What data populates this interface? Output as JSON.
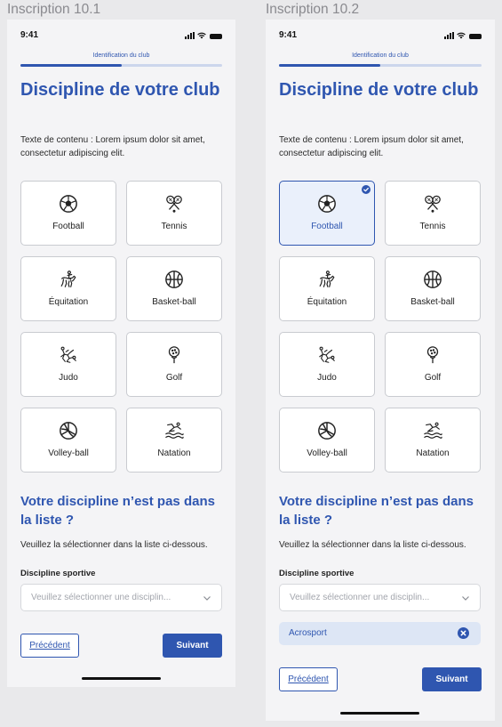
{
  "screens": [
    {
      "frame_title": "Inscription 10.1",
      "status_time": "9:41",
      "step_label": "Identification du club",
      "progress": 0.5,
      "page_title": "Discipline de votre club",
      "intro": "Texte de contenu : Lorem ipsum dolor sit amet, consectetur adipiscing elit.",
      "sports": [
        {
          "label": "Football",
          "icon": "football-icon",
          "selected": false
        },
        {
          "label": "Tennis",
          "icon": "tennis-icon",
          "selected": false
        },
        {
          "label": "Équitation",
          "icon": "equestrian-icon",
          "selected": false
        },
        {
          "label": "Basket-ball",
          "icon": "basketball-icon",
          "selected": false
        },
        {
          "label": "Judo",
          "icon": "judo-icon",
          "selected": false
        },
        {
          "label": "Golf",
          "icon": "golf-icon",
          "selected": false
        },
        {
          "label": "Volley-ball",
          "icon": "volleyball-icon",
          "selected": false
        },
        {
          "label": "Natation",
          "icon": "swimming-icon",
          "selected": false
        }
      ],
      "other_title": "Votre discipline n’est pas dans la liste ?",
      "other_text": "Veuillez la sélectionner dans la liste ci-dessous.",
      "field_label": "Discipline sportive",
      "select_placeholder": "Veuillez sélectionner une disciplin...",
      "prev_label": "Précédent",
      "next_label": "Suivant"
    },
    {
      "frame_title": "Inscription 10.2",
      "status_time": "9:41",
      "step_label": "Identification du club",
      "progress": 0.5,
      "page_title": "Discipline de votre club",
      "intro": "Texte de contenu : Lorem ipsum dolor sit amet, consectetur adipiscing elit.",
      "sports": [
        {
          "label": "Football",
          "icon": "football-icon",
          "selected": true
        },
        {
          "label": "Tennis",
          "icon": "tennis-icon",
          "selected": false
        },
        {
          "label": "Équitation",
          "icon": "equestrian-icon",
          "selected": false
        },
        {
          "label": "Basket-ball",
          "icon": "basketball-icon",
          "selected": false
        },
        {
          "label": "Judo",
          "icon": "judo-icon",
          "selected": false
        },
        {
          "label": "Golf",
          "icon": "golf-icon",
          "selected": false
        },
        {
          "label": "Volley-ball",
          "icon": "volleyball-icon",
          "selected": false
        },
        {
          "label": "Natation",
          "icon": "swimming-icon",
          "selected": false
        }
      ],
      "other_title": "Votre discipline n’est pas dans la liste ?",
      "other_text": "Veuillez la sélectionner dans la liste ci-dessous.",
      "field_label": "Discipline sportive",
      "select_placeholder": "Veuillez sélectionner une disciplin...",
      "chip_label": "Acrosport",
      "prev_label": "Précédent",
      "next_label": "Suivant"
    }
  ],
  "colors": {
    "primary": "#2f56b0",
    "selected_bg": "#eaf0fb",
    "chip_bg": "#dde6f5",
    "screen_bg": "#f4f4f6"
  }
}
